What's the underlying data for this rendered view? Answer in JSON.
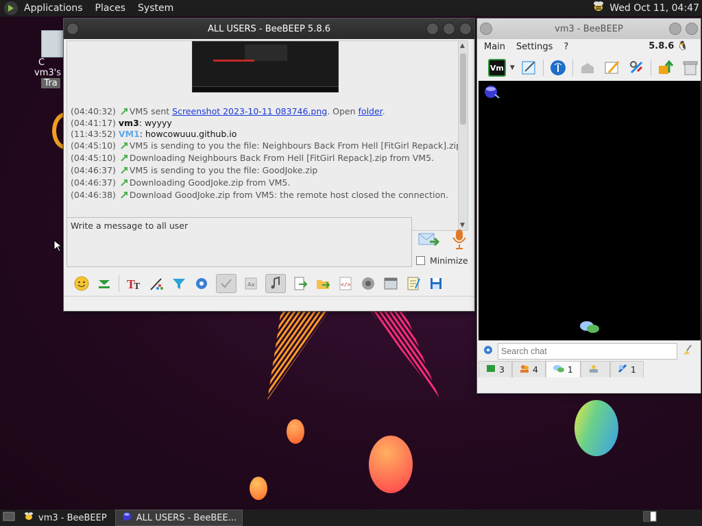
{
  "top_panel": {
    "menus": [
      "Applications",
      "Places",
      "System"
    ],
    "clock": "Wed Oct 11, 04:47"
  },
  "desktop_icon": {
    "label_line1": "C",
    "label_line2": "vm3's h",
    "label_line3": "Tra"
  },
  "chat_window": {
    "title": "ALL USERS - BeeBEEP 5.8.6",
    "log": [
      {
        "ts": "(04:40:32)",
        "pre": "VM5 sent ",
        "link": "Screenshot 2023-10-11 083746.png",
        "mid": ". Open ",
        "link2": "folder",
        "post": "."
      },
      {
        "ts": "(04:41:17)",
        "user": "vm3",
        "text": ": wyyyy"
      },
      {
        "ts": "(11:43:52)",
        "user_blue": "VM1",
        "text": ": howcowuuu.github.io"
      },
      {
        "ts": "(04:45:10)",
        "text": "VM5 is sending to you the file: Neighbours Back From Hell [FitGirl Repack].zip"
      },
      {
        "ts": "(04:45:10)",
        "text": "Downloading Neighbours Back From Hell [FitGirl Repack].zip from VM5."
      },
      {
        "ts": "(04:46:37)",
        "text": "VM5 is sending to you the file: GoodJoke.zip"
      },
      {
        "ts": "(04:46:37)",
        "text": "Downloading GoodJoke.zip from VM5."
      },
      {
        "ts": "(04:46:38)",
        "text": "Download GoodJoke.zip from VM5: the remote host closed the connection."
      }
    ],
    "input_placeholder": "Write a message to all user",
    "minimize_label": "Minimize"
  },
  "main_window": {
    "title": "vm3 - BeeBEEP",
    "menu": [
      "Main",
      "Settings",
      "?"
    ],
    "version": "5.8.6",
    "vm_badge": "Vm",
    "search_placeholder": "Search chat",
    "tabs": [
      {
        "icon": "users-icon",
        "count": "3"
      },
      {
        "icon": "groups-icon",
        "count": "4"
      },
      {
        "icon": "chats-icon",
        "count": "1"
      },
      {
        "icon": "shared-icon",
        "count": ""
      },
      {
        "icon": "files-icon",
        "count": "1"
      }
    ]
  },
  "taskbar": {
    "tasks": [
      "vm3 - BeeBEEP",
      "ALL USERS - BeeBEE..."
    ]
  }
}
